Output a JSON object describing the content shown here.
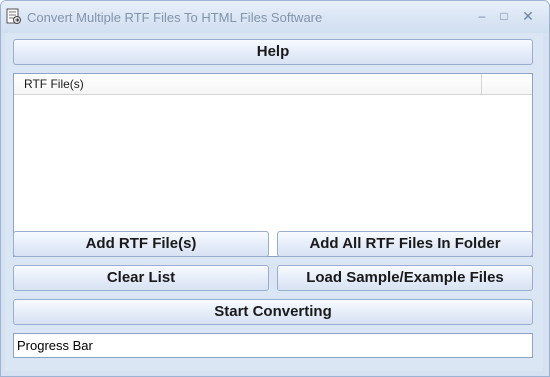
{
  "window": {
    "title": "Convert Multiple RTF Files To HTML Files Software",
    "controls": {
      "minimize": "–",
      "maximize": "□",
      "close": "✕"
    }
  },
  "toolbar": {
    "help_label": "Help"
  },
  "file_list": {
    "columns": [
      "RTF File(s)"
    ],
    "rows": []
  },
  "actions": {
    "add_files": "Add RTF File(s)",
    "add_folder": "Add All RTF Files In Folder",
    "clear_list": "Clear List",
    "load_sample": "Load Sample/Example Files",
    "start": "Start Converting"
  },
  "progress": {
    "label": "Progress Bar"
  },
  "colors": {
    "title_text": "#8393aa",
    "window_bg": "#dbe6f4",
    "button_border": "#98add0"
  },
  "icons": {
    "app": "document-convert-icon"
  }
}
